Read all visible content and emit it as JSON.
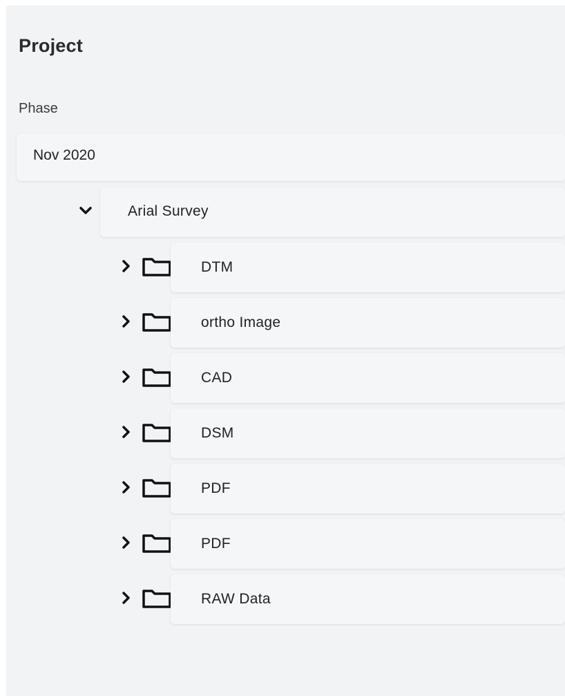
{
  "panel": {
    "title": "Project",
    "phase_label": "Phase",
    "phase_value": "Nov 2020"
  },
  "tree": {
    "subfolder": {
      "label": "Arial Survey",
      "expanded": true,
      "chevron_icon": "chevron-down-icon"
    },
    "folders": [
      {
        "label": "DTM",
        "chevron_icon": "chevron-right-icon",
        "icon": "folder-icon"
      },
      {
        "label": "ortho Image",
        "chevron_icon": "chevron-right-icon",
        "icon": "folder-icon"
      },
      {
        "label": "CAD",
        "chevron_icon": "chevron-right-icon",
        "icon": "folder-icon"
      },
      {
        "label": "DSM",
        "chevron_icon": "chevron-right-icon",
        "icon": "folder-icon"
      },
      {
        "label": "PDF",
        "chevron_icon": "chevron-right-icon",
        "icon": "folder-icon"
      },
      {
        "label": "PDF",
        "chevron_icon": "chevron-right-icon",
        "icon": "folder-icon"
      },
      {
        "label": "RAW Data",
        "chevron_icon": "chevron-right-icon",
        "icon": "folder-icon"
      }
    ]
  },
  "colors": {
    "panel_bg": "#f2f3f5",
    "row_bg": "#f5f6f8",
    "text": "#222222",
    "icon": "#111111"
  }
}
